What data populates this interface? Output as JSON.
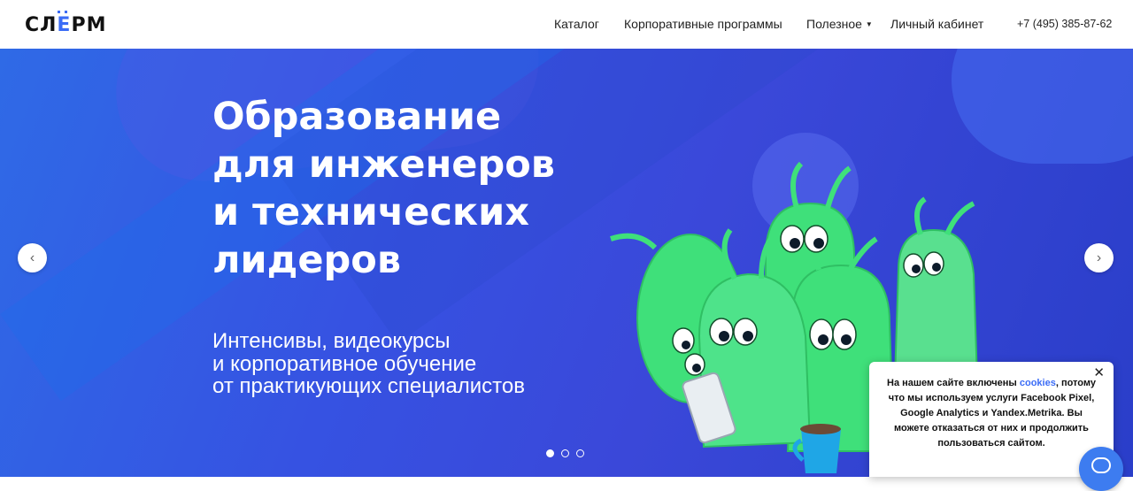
{
  "header": {
    "logo_text_before": "СЛ",
    "logo_text_accent": "Е",
    "logo_text_after": "РМ",
    "nav": {
      "catalog": "Каталог",
      "corporate": "Корпоративные программы",
      "useful": "Полезное",
      "useful_caret": "▼",
      "cabinet": "Личный кабинет"
    },
    "phone": "+7 (495) 385-87-62"
  },
  "hero": {
    "headline": [
      "Образование",
      "для инженеров",
      "и технических",
      "лидеров"
    ],
    "subline": [
      "Интенсивы, видеокурсы",
      "и корпоративное обучение",
      "от практикующих специалистов"
    ],
    "arrow_left": "‹",
    "arrow_right": "›",
    "slides": 3,
    "active_slide": 1
  },
  "cookie": {
    "text_before": "На нашем сайте включены ",
    "link": "cookies",
    "text_after": ", потому что мы используем услуги Facebook Pixel, Google Analytics и Yandex.Metrika. Вы можете отказаться от них и продолжить пользоваться сайтом.",
    "close": "✕"
  },
  "colors": {
    "accent": "#3b6cf6",
    "hero_bg": "#3652e2",
    "creature_green": "#3fe07a"
  }
}
